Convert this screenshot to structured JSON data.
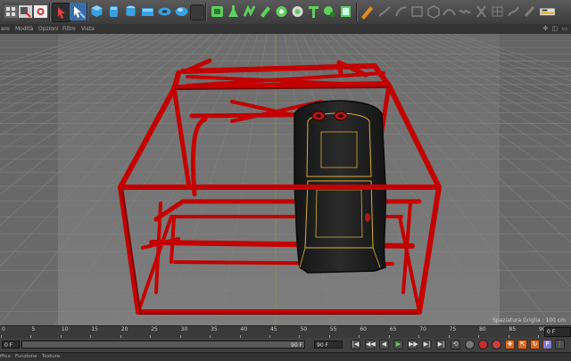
{
  "toolbar": {
    "tools": [
      {
        "name": "undo-icon"
      },
      {
        "name": "render-region-icon"
      },
      {
        "name": "render-view-icon"
      },
      {
        "name": "select-arrow-icon"
      },
      {
        "name": "live-select-icon"
      },
      {
        "name": "cube-icon"
      },
      {
        "name": "cylinder-icon"
      },
      {
        "name": "disc-icon"
      },
      {
        "name": "torus-icon"
      },
      {
        "name": "sphere-icon"
      },
      {
        "name": "plane-icon"
      },
      {
        "name": "spline-icon"
      },
      {
        "name": "subdivision-icon"
      },
      {
        "name": "deformer-icon"
      },
      {
        "name": "effector-icon"
      },
      {
        "name": "generator-icon"
      },
      {
        "name": "scene-icon"
      },
      {
        "name": "camera-icon"
      },
      {
        "name": "light-icon"
      },
      {
        "name": "tag-icon"
      },
      {
        "name": "snap-icon"
      },
      {
        "name": "sculpt-icon"
      }
    ],
    "accent_color": "#3aa0e0",
    "green_color": "#5fd05f"
  },
  "viewport_menu": {
    "items": [
      "are",
      "Modità",
      "Opzioni",
      "Filtro",
      "Vista"
    ],
    "right_icons": "✥ ◫ ▭"
  },
  "viewport": {
    "grid_label": "Spaziatura Griglia : 100 cm",
    "cage_color": "#c40000",
    "seat_color": "#1e1e1e",
    "stitch_color": "#d7b13a"
  },
  "timeline": {
    "ticks": [
      "0",
      "5",
      "10",
      "15",
      "20",
      "25",
      "30",
      "35",
      "40",
      "45",
      "50",
      "55",
      "60",
      "65",
      "70",
      "75",
      "80",
      "85",
      "90"
    ],
    "frame_right": "0 F"
  },
  "transport": {
    "start_field": "0 F",
    "end_field": "90 F",
    "mid_field": "90 F",
    "buttons": [
      "|◀",
      "◀◀",
      "◀",
      "▶",
      "▶▶",
      "▶|",
      "⟲"
    ]
  },
  "bottom_menu": {
    "items": [
      "ffica",
      "Funzione",
      "Texture"
    ]
  }
}
